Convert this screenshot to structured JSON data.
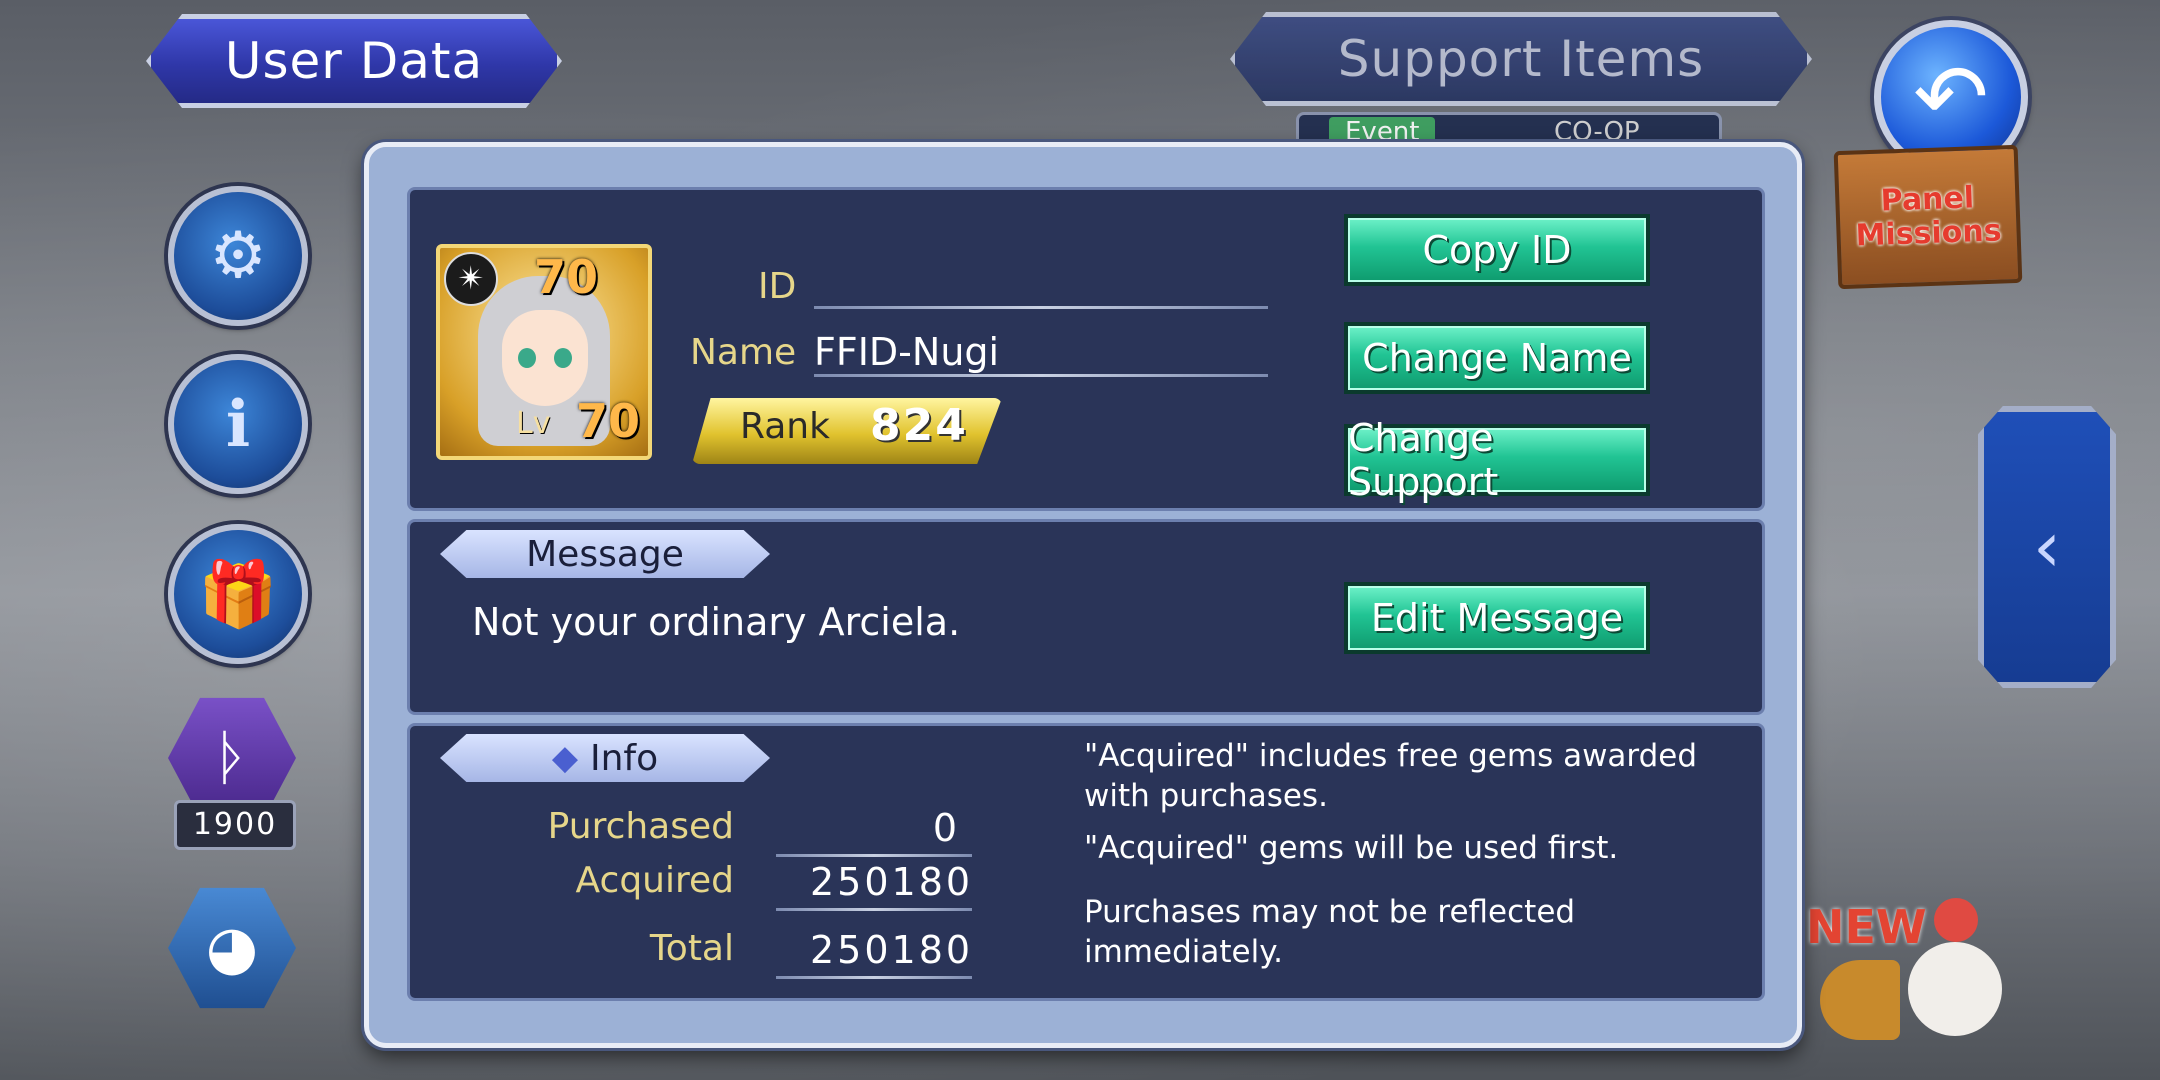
{
  "header": {
    "title": "User Data",
    "support_items": "Support Items",
    "tabs": {
      "event": "Event",
      "coop": "CO-OP"
    }
  },
  "side": {
    "left_count": "1900",
    "panel_missions_line1": "Panel",
    "panel_missions_line2": "Missions",
    "new_label": "NEW"
  },
  "profile": {
    "id_label": "ID",
    "id_value": "",
    "name_label": "Name",
    "name_value": "FFID-Nugi",
    "rank_label": "Rank",
    "rank_value": "824",
    "level_top": "70",
    "level_label": "Lv",
    "level_value": "70",
    "buttons": {
      "copy_id": "Copy ID",
      "change_name": "Change Name",
      "change_support": "Change Support"
    }
  },
  "message": {
    "title": "Message",
    "text": "Not your ordinary Arciela.",
    "edit_button": "Edit Message"
  },
  "info": {
    "title": "Info",
    "rows": [
      {
        "label": "Purchased",
        "value": "0"
      },
      {
        "label": "Acquired",
        "value": "250180"
      },
      {
        "label": "Total",
        "value": "250180"
      }
    ],
    "notes": [
      "\"Acquired\" includes free gems awarded with purchases.",
      "\"Acquired\" gems will be used first.",
      "Purchases may not be reflected immediately."
    ]
  },
  "colors": {
    "accent_green": "#21c494",
    "panel_bg": "#2a3458",
    "label_gold": "#e6d68a"
  }
}
